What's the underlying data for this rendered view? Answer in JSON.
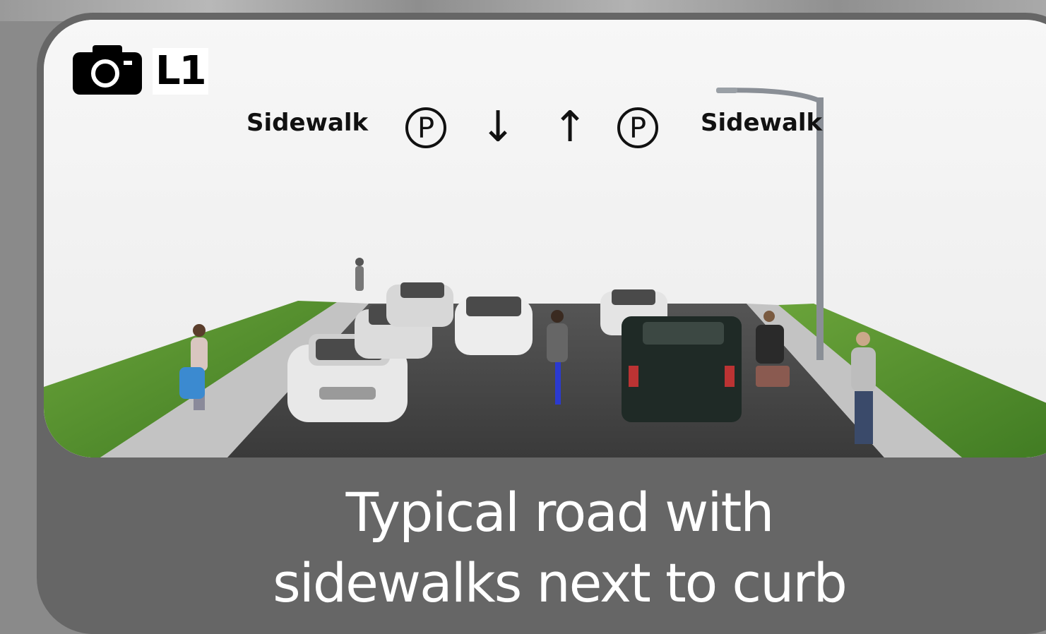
{
  "view_id": "L1",
  "labels": {
    "left_sidewalk": "Sidewalk",
    "right_sidewalk": "Sidewalk",
    "parking_left": "P",
    "parking_right": "P",
    "lane_down": "↓",
    "lane_up": "↑"
  },
  "caption": {
    "line1": "Typical road with",
    "line2": "sidewalks next to curb"
  },
  "icons": {
    "camera": "camera-icon",
    "parking": "parking-icon"
  },
  "colors": {
    "card": "#666666",
    "grass": "#4e8a2a",
    "road": "#3f3f3f",
    "sidewalk": "#bdbdbd",
    "caption_text": "#ffffff"
  }
}
